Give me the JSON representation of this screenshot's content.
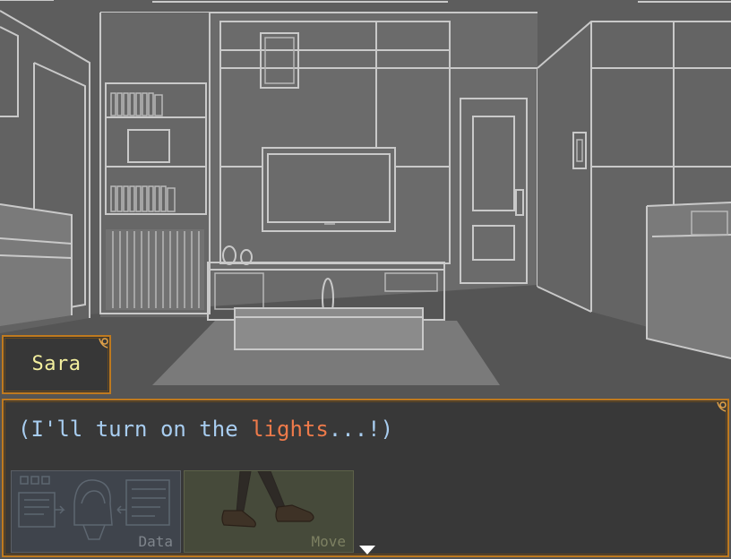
{
  "speaker": {
    "name": "Sara"
  },
  "message": {
    "before": "(I'll turn on the ",
    "highlight": "lights",
    "after": "...!)"
  },
  "menu": {
    "data_label": "Data",
    "move_label": "Move"
  },
  "colors": {
    "frame": "#c07a1e",
    "name_text": "#f3ef9e",
    "message_text": "#a8cdf0",
    "highlight_text": "#ee7a4a",
    "window_bg": "#383838"
  },
  "icons": {
    "continue": "continue-arrow-icon",
    "corner": "corner-ornament-icon"
  }
}
